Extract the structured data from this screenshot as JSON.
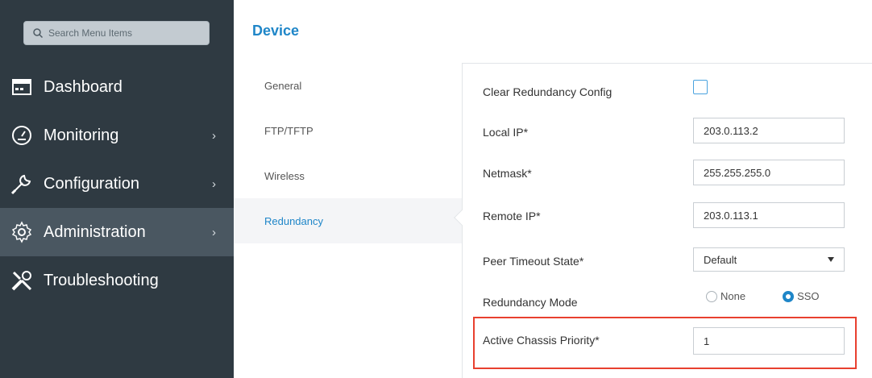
{
  "sidebar": {
    "search_placeholder": "Search Menu Items",
    "items": [
      {
        "label": "Dashboard",
        "icon": "dashboard-icon",
        "chevron": ""
      },
      {
        "label": "Monitoring",
        "icon": "gauge-icon",
        "chevron": "›"
      },
      {
        "label": "Configuration",
        "icon": "wrench-icon",
        "chevron": "›"
      },
      {
        "label": "Administration",
        "icon": "gear-icon",
        "chevron": "›",
        "active": true
      },
      {
        "label": "Troubleshooting",
        "icon": "tools-icon",
        "chevron": ""
      }
    ]
  },
  "page": {
    "title": "Device"
  },
  "subnav": {
    "items": [
      "General",
      "FTP/TFTP",
      "Wireless",
      "Redundancy"
    ],
    "active": "Redundancy"
  },
  "form": {
    "clear_redundancy_label": "Clear Redundancy Config",
    "local_ip_label": "Local IP*",
    "local_ip_value": "203.0.113.2",
    "netmask_label": "Netmask*",
    "netmask_value": "255.255.255.0",
    "remote_ip_label": "Remote IP*",
    "remote_ip_value": "203.0.113.1",
    "peer_timeout_label": "Peer Timeout State*",
    "peer_timeout_value": "Default",
    "redundancy_mode_label": "Redundancy Mode",
    "redundancy_mode_none": "None",
    "redundancy_mode_sso": "SSO",
    "redundancy_mode_selected": "SSO",
    "active_chassis_label": "Active Chassis Priority*",
    "active_chassis_value": "1"
  },
  "colors": {
    "sidebar_bg": "#2f3a42",
    "sidebar_active": "#4a5761",
    "accent": "#1f86c8",
    "highlight": "#e8402f"
  }
}
